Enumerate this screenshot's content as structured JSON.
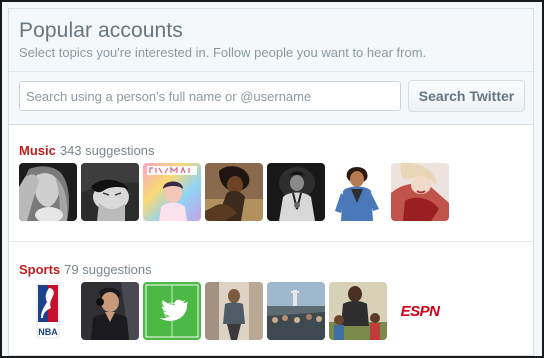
{
  "header": {
    "title": "Popular accounts",
    "subtitle": "Select topics you're interested in. Follow people you want to hear from."
  },
  "search": {
    "placeholder": "Search using a person's full name or @username",
    "button_label": "Search Twitter"
  },
  "categories": [
    {
      "name": "Music",
      "count_label": "343 suggestions",
      "accounts": [
        "shakira",
        "rihanna-bw",
        "katy-perry-prismatic",
        "janelle-monae",
        "justin-timberlake",
        "bruno-mars",
        "taylor-swift"
      ]
    },
    {
      "name": "Sports",
      "count_label": "79 suggestions",
      "accounts": [
        "nba-logo",
        "athlete-headphones",
        "twitter-sports-logo",
        "athlete-portrait",
        "stadium-crowd",
        "athlete-with-kids",
        "espn-logo"
      ]
    }
  ],
  "logos": {
    "espn": "ESPN",
    "nba": "NBA"
  },
  "colors": {
    "accent_red": "#c0201f",
    "twitter_green": "#4cb846",
    "nba_blue": "#1d428a",
    "nba_red": "#c8102e"
  }
}
